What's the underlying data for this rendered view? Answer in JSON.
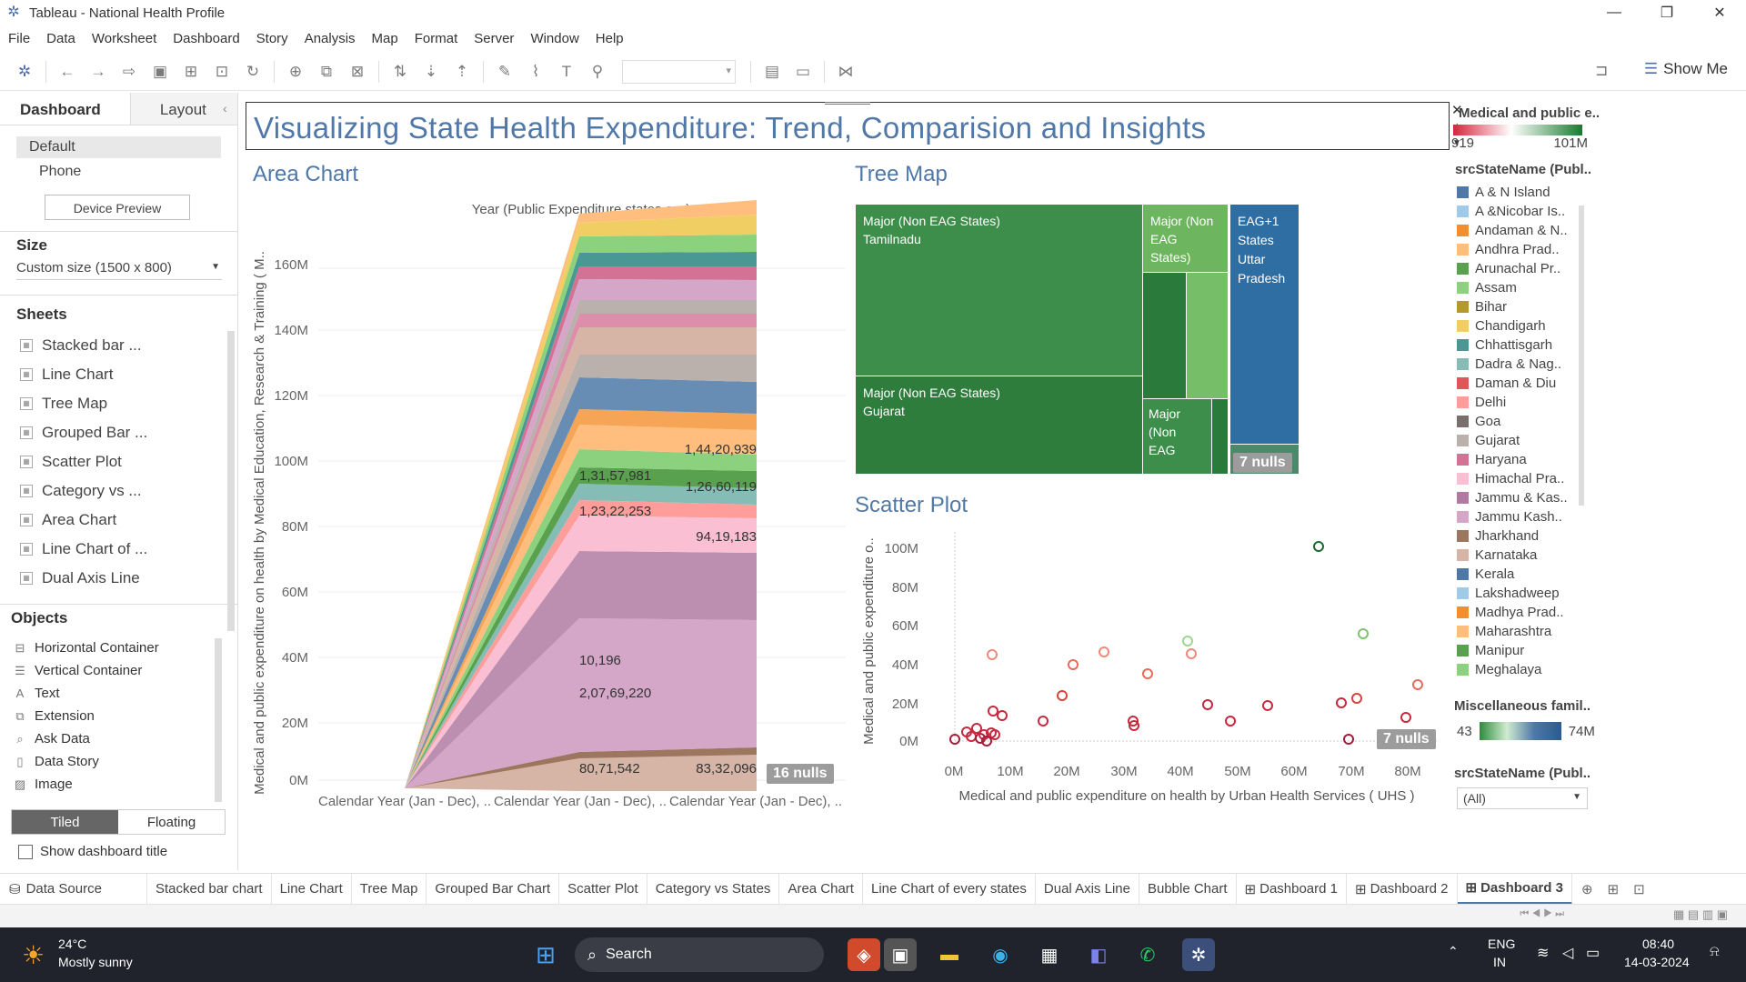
{
  "app": {
    "title": "Tableau - National Health Profile"
  },
  "menu": [
    "File",
    "Data",
    "Worksheet",
    "Dashboard",
    "Story",
    "Analysis",
    "Map",
    "Format",
    "Server",
    "Window",
    "Help"
  ],
  "toolbar": {
    "show_me": "Show Me"
  },
  "left_pane": {
    "tabs": [
      "Dashboard",
      "Layout"
    ],
    "devices": [
      "Default",
      "Phone"
    ],
    "device_preview": "Device Preview",
    "size_heading": "Size",
    "size_value": "Custom size (1500 x 800)",
    "sheets_heading": "Sheets",
    "sheets": [
      "Stacked bar ...",
      "Line Chart",
      "Tree Map",
      "Grouped Bar ...",
      "Scatter Plot",
      "Category vs ...",
      "Area Chart",
      "Line Chart of ...",
      "Dual Axis Line"
    ],
    "objects_heading": "Objects",
    "objects": [
      {
        "label": "Horizontal Container",
        "icon": "horizontal-container-icon"
      },
      {
        "label": "Vertical Container",
        "icon": "vertical-container-icon"
      },
      {
        "label": "Text",
        "icon": "text-icon"
      },
      {
        "label": "Extension",
        "icon": "extension-icon"
      },
      {
        "label": "Ask Data",
        "icon": "ask-data-icon"
      },
      {
        "label": "Data Story",
        "icon": "data-story-icon"
      },
      {
        "label": "Image",
        "icon": "image-icon"
      }
    ],
    "layout_mode": [
      "Tiled",
      "Floating"
    ],
    "show_title": "Show dashboard title"
  },
  "dashboard": {
    "title": "Visualizing State Health Expenditure: Trend, Comparision and Insights",
    "area": {
      "title": "Area Chart",
      "header": "Year (Public Expenditure states.csv)",
      "ylabel": "Medical and public expenditure on health by Medical Education, Research & Training ( M..",
      "xticks": [
        "Calendar Year (Jan - Dec), ..",
        "Calendar Year (Jan - Dec), ..",
        "Calendar Year (Jan - Dec), .."
      ],
      "yticks": [
        "0M",
        "20M",
        "40M",
        "60M",
        "80M",
        "100M",
        "120M",
        "140M",
        "160M"
      ],
      "labels": [
        "1,44,20,939",
        "1,31,57,981",
        "1,26,60,119",
        "1,23,22,253",
        "94,19,183",
        "10,196",
        "2,07,69,220",
        "80,71,542",
        "83,32,096"
      ],
      "nulls": "16 nulls"
    },
    "tree": {
      "title": "Tree Map",
      "cells": [
        "Major (Non EAG States)\nTamilnadu",
        "Major (Non EAG States)",
        "EAG+1 States Uttar Pradesh",
        "Major (Non EAG States)\nGujarat",
        "Major (Non EAG"
      ],
      "nulls": "7 nulls"
    },
    "scatter": {
      "title": "Scatter Plot",
      "xlabel": "Medical and public expenditure on health by Urban Health Services ( UHS )",
      "ylabel": "Medical and public expenditure o..",
      "xticks": [
        "0M",
        "10M",
        "20M",
        "30M",
        "40M",
        "50M",
        "60M",
        "70M",
        "80M"
      ],
      "yticks": [
        "0M",
        "20M",
        "40M",
        "60M",
        "80M",
        "100M"
      ],
      "nulls": "7 nulls"
    },
    "legend": {
      "color_title": "Medical and public e..",
      "color_min": "919",
      "color_max": "101M",
      "state_title": "srcStateName (Publ..",
      "states": [
        "A & N Island",
        "A &Nicobar Is..",
        "Andaman & N..",
        "Andhra Prad..",
        "Arunachal Pr..",
        "Assam",
        "Bihar",
        "Chandigarh",
        "Chhattisgarh",
        "Dadra & Nag..",
        "Daman & Diu",
        "Delhi",
        "Goa",
        "Gujarat",
        "Haryana",
        "Himachal Pra..",
        "Jammu & Kas..",
        "Jammu Kash..",
        "Jharkhand",
        "Karnataka",
        "Kerala",
        "Lakshadweep",
        "Madhya Prad..",
        "Maharashtra",
        "Manipur",
        "Meghalaya"
      ],
      "state_colors": [
        "#4e79a7",
        "#a0cbe8",
        "#f28e2b",
        "#ffbe7d",
        "#59a14f",
        "#8cd17d",
        "#b6992d",
        "#f1ce63",
        "#499894",
        "#86bcb6",
        "#e15759",
        "#ff9d9a",
        "#79706e",
        "#bab0ac",
        "#d37295",
        "#fabfd2",
        "#b07aa1",
        "#d4a6c8",
        "#9d7660",
        "#d7b5a6",
        "#4e79a7",
        "#a0cbe8",
        "#f28e2b",
        "#ffbe7d",
        "#59a14f",
        "#8cd17d"
      ],
      "misc_title": "Miscellaneous famil..",
      "misc_min": "43",
      "misc_max": "74M",
      "filter_title": "srcStateName (Publ..",
      "filter_value": "(All)"
    }
  },
  "sheet_tabs": [
    "Data Source",
    "Stacked bar chart",
    "Line Chart",
    "Tree Map",
    "Grouped Bar Chart",
    "Scatter Plot",
    "Category vs States",
    "Area Chart",
    "Line Chart of every states",
    "Dual Axis Line",
    "Bubble Chart",
    "Dashboard 1",
    "Dashboard 2",
    "Dashboard 3"
  ],
  "active_tab": "Dashboard 3",
  "taskbar": {
    "temp": "24°C",
    "weather": "Mostly sunny",
    "search": "Search",
    "lang1": "ENG",
    "lang2": "IN",
    "time": "08:40",
    "date": "14-03-2024"
  }
}
